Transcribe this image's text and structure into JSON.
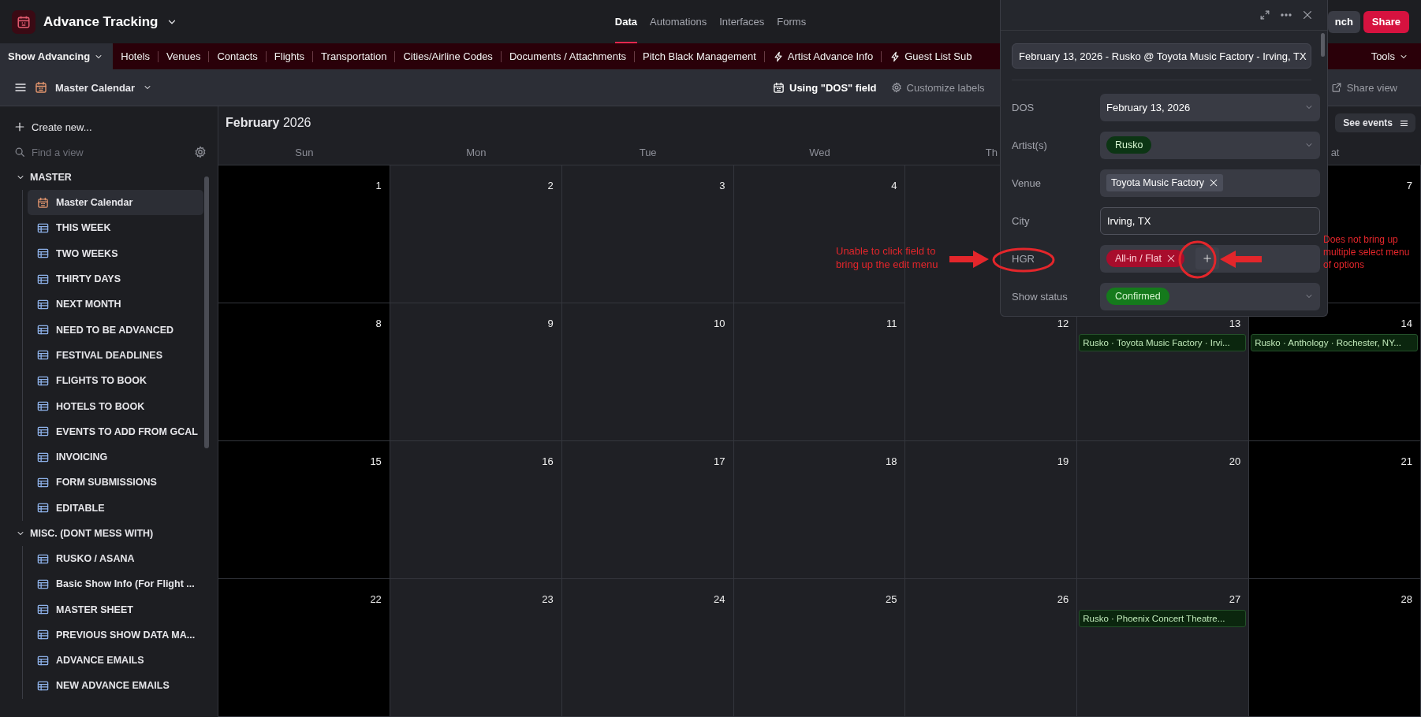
{
  "app": {
    "title": "Advance Tracking"
  },
  "nav_tabs": [
    {
      "label": "Data",
      "selected": true
    },
    {
      "label": "Automations",
      "selected": false
    },
    {
      "label": "Interfaces",
      "selected": false
    },
    {
      "label": "Forms",
      "selected": false
    }
  ],
  "header_buttons": [
    {
      "label": "nch",
      "kind": "secondary"
    },
    {
      "label": "Share",
      "kind": "primary"
    }
  ],
  "table_tabs": {
    "items": [
      {
        "label": "Show Advancing",
        "kind": "menu",
        "selected": true
      },
      {
        "label": "Hotels",
        "kind": "table",
        "selected": false
      },
      {
        "label": "Venues",
        "kind": "table",
        "selected": false
      },
      {
        "label": "Contacts",
        "kind": "table",
        "selected": false
      },
      {
        "label": "Flights",
        "kind": "table",
        "selected": false
      },
      {
        "label": "Transportation",
        "kind": "table",
        "selected": false
      },
      {
        "label": "Cities/Airline Codes",
        "kind": "table",
        "selected": false
      },
      {
        "label": "Documents / Attachments",
        "kind": "table",
        "selected": false
      },
      {
        "label": "Pitch Black Management",
        "kind": "table",
        "selected": false
      },
      {
        "label": "Artist Advance Info",
        "kind": "bolt",
        "selected": false
      },
      {
        "label": "Guest List Sub",
        "kind": "bolt",
        "selected": false
      }
    ],
    "tools": "Tools"
  },
  "view_bar": {
    "view_name": "Master Calendar",
    "date_field": "Using \"DOS\" field",
    "customize": "Customize labels",
    "share": "Share view"
  },
  "sidebar": {
    "create": "Create new...",
    "search_placeholder": "Find a view",
    "sections": [
      {
        "title": "MASTER",
        "expanded": true,
        "items": [
          {
            "label": "Master Calendar",
            "kind": "calendar",
            "selected": true
          },
          {
            "label": "THIS WEEK",
            "kind": "grid",
            "selected": false
          },
          {
            "label": "TWO WEEKS",
            "kind": "grid",
            "selected": false
          },
          {
            "label": "THIRTY DAYS",
            "kind": "grid",
            "selected": false
          },
          {
            "label": "NEXT MONTH",
            "kind": "grid",
            "selected": false
          },
          {
            "label": "NEED TO BE ADVANCED",
            "kind": "grid",
            "selected": false
          },
          {
            "label": "FESTIVAL DEADLINES",
            "kind": "grid",
            "selected": false
          },
          {
            "label": "FLIGHTS TO BOOK",
            "kind": "grid",
            "selected": false
          },
          {
            "label": "HOTELS TO BOOK",
            "kind": "grid",
            "selected": false
          },
          {
            "label": "EVENTS TO ADD FROM GCAL",
            "kind": "grid",
            "selected": false
          },
          {
            "label": "INVOICING",
            "kind": "grid",
            "selected": false
          },
          {
            "label": "FORM SUBMISSIONS",
            "kind": "grid",
            "selected": false
          },
          {
            "label": "EDITABLE",
            "kind": "grid",
            "selected": false
          }
        ]
      },
      {
        "title": "MISC. (DONT MESS WITH)",
        "expanded": true,
        "items": [
          {
            "label": "RUSKO / ASANA",
            "kind": "grid",
            "selected": false
          },
          {
            "label": "Basic Show Info (For Flight ...",
            "kind": "grid",
            "selected": false
          },
          {
            "label": "MASTER SHEET",
            "kind": "grid",
            "selected": false
          },
          {
            "label": "PREVIOUS SHOW DATA MA...",
            "kind": "grid",
            "selected": false
          },
          {
            "label": "ADVANCE EMAILS",
            "kind": "grid",
            "selected": false
          },
          {
            "label": "NEW ADVANCE EMAILS",
            "kind": "grid",
            "selected": false
          }
        ]
      }
    ]
  },
  "calendar": {
    "title": "**February** 2026",
    "see_events": "See events",
    "weekdays": [
      "Sun",
      "Mon",
      "Tue",
      "Wed",
      "Th",
      "at"
    ],
    "weeks": [
      [
        {
          "day": "1"
        },
        {
          "day": "2"
        },
        {
          "day": "3"
        },
        {
          "day": "4"
        },
        {
          "day": "7"
        }
      ],
      [
        {
          "day": "8"
        },
        {
          "day": "9"
        },
        {
          "day": "10"
        },
        {
          "day": "11"
        },
        {
          "day": "12"
        },
        {
          "day": "13",
          "events": [
            "Rusko · Toyota Music Factory · Irvi..."
          ]
        },
        {
          "day": "14",
          "events": [
            "Rusko · Anthology · Rochester, NY..."
          ]
        }
      ],
      [
        {
          "day": "15"
        },
        {
          "day": "16"
        },
        {
          "day": "17"
        },
        {
          "day": "18"
        },
        {
          "day": "19"
        },
        {
          "day": "20"
        },
        {
          "day": "21"
        }
      ],
      [
        {
          "day": "22"
        },
        {
          "day": "23"
        },
        {
          "day": "24"
        },
        {
          "day": "25"
        },
        {
          "day": "26"
        },
        {
          "day": "27",
          "events": [
            "Rusko · Phoenix Concert Theatre..."
          ]
        },
        {
          "day": "28"
        }
      ]
    ]
  },
  "record": {
    "title": "February 13, 2026 - Rusko @ Toyota Music Factory - Irving, TX",
    "fields": [
      {
        "label": "DOS",
        "kind": "date",
        "value": "February 13, 2026"
      },
      {
        "label": "Artist(s)",
        "kind": "select",
        "chips": [
          {
            "label": "Rusko",
            "color": "#0c3514"
          }
        ]
      },
      {
        "label": "Venue",
        "kind": "link",
        "chips": [
          {
            "label": "Toyota Music Factory"
          }
        ]
      },
      {
        "label": "City",
        "kind": "text",
        "value": "Irving, TX"
      },
      {
        "label": "HGR",
        "kind": "multi",
        "chips": [
          {
            "label": "All-in / Flat",
            "color": "#a80d2c"
          }
        ]
      },
      {
        "label": "Show status",
        "kind": "select",
        "chips": [
          {
            "label": "Confirmed",
            "color": "#157a1c"
          }
        ]
      }
    ]
  },
  "annotations": [
    {
      "kind": "left",
      "lines": [
        "Unable to click field to",
        "bring up the edit menu"
      ]
    },
    {
      "kind": "right",
      "lines": [
        "Does not bring up",
        "multiple select menu",
        "of options"
      ]
    }
  ]
}
